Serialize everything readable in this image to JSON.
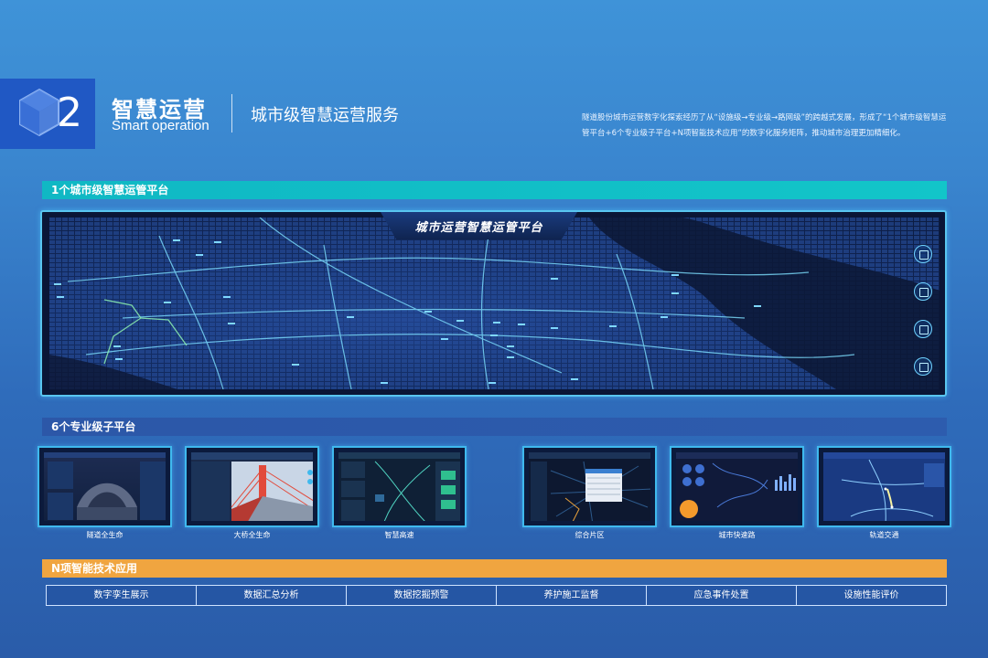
{
  "header": {
    "section_number": "2",
    "title_cn": "智慧运营",
    "title_en": "Smart operation",
    "subtitle": "城市级智慧运营服务",
    "intro": "隧道股份城市运营数字化探索经历了从“设施级→专业级→路网级”的跨越式发展，形成了“1个城市级智慧运管平台+6个专业级子平台+N项智能技术应用”的数字化服务矩阵，推动城市治理更加精细化。"
  },
  "sections": {
    "city_platform_label": "1个城市级智慧运管平台",
    "sub_platforms_label": "6个专业级子平台",
    "tech_label": "N项智能技术应用"
  },
  "platform": {
    "title": "城市运营智慧运管平台"
  },
  "sub_platforms": [
    {
      "label": "隧道全生命"
    },
    {
      "label": "大桥全生命"
    },
    {
      "label": "智慧高速"
    },
    {
      "label": "综合片区"
    },
    {
      "label": "城市快速路"
    },
    {
      "label": "轨道交通"
    }
  ],
  "tech_apps": [
    "数字孪生展示",
    "数据汇总分析",
    "数据挖掘预警",
    "养护施工监督",
    "应急事件处置",
    "设施性能评价"
  ],
  "colors": {
    "background": "#3a86cf",
    "teal_bar": "#12c5c9",
    "blue_bar": "#2d5cae",
    "orange_bar": "#f0a540",
    "logo_box": "#2058c4",
    "panel_border": "#59c6f0"
  }
}
